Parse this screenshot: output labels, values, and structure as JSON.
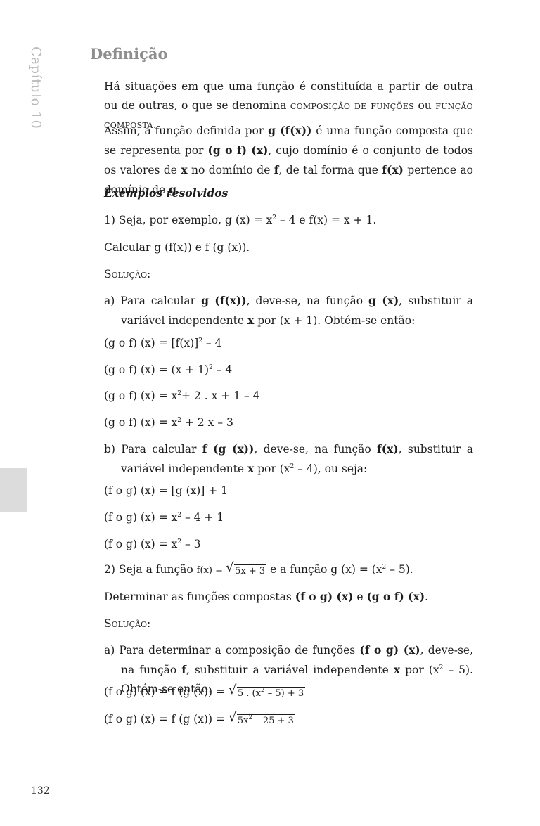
{
  "side": {
    "chapter": "Capítulo 10",
    "page_number": "132"
  },
  "heading": "Definição",
  "intro": {
    "p1_text": "Há situações em que uma função é constituída a partir de outra ou de outras, o que se denomina ",
    "p1_term1": "composição de funções",
    "p1_or": " ou ",
    "p1_term2": "função composta",
    "p1_end": ".",
    "p2_a": "Assim, a função definida por ",
    "p2_b": "g (f(x))",
    "p2_c": " é uma função composta que se representa por ",
    "p2_d": "(g o f) (x)",
    "p2_e": ", cujo domínio é o conjunto de todos os valores de ",
    "p2_f": "x",
    "p2_g": " no domínio de ",
    "p2_h": "f",
    "p2_i": ", de tal forma que ",
    "p2_j": "f(x)",
    "p2_k": " pertence ao domínio de ",
    "p2_l": "g",
    "p2_m": "."
  },
  "examples_title": "Exemplos resolvidos",
  "ex1": {
    "stmt_a": "1)  Seja, por exemplo, g (x) = x",
    "stmt_sup": "2",
    "stmt_b": " – 4 e f(x) = x + 1.",
    "task": "Calcular g (f(x)) e f (g (x)).",
    "solution_label": "Solução:",
    "a_1": "a)  Para calcular ",
    "a_2": "g (f(x))",
    "a_3": ", deve-se, na função ",
    "a_4": "g (x)",
    "a_5": ", substituir a variável independente ",
    "a_6": "x",
    "a_7": " por (x + 1). Obtém-se então:",
    "eq1_a": "(g o f) (x) = [f(x)]",
    "eq1_b": " – 4",
    "eq2_a": "(g o f) (x) = (x + 1)",
    "eq2_b": " – 4",
    "eq3_a": "(g o f) (x) = x",
    "eq3_b": "+ 2 . x + 1 – 4",
    "eq4_a": "(g o f) (x) = x",
    "eq4_b": " + 2 x – 3",
    "b_1": "b)  Para calcular ",
    "b_2": "f (g (x))",
    "b_3": ", deve-se, na função ",
    "b_4": "f(x)",
    "b_5": ", substituir a variável independente ",
    "b_6": "x",
    "b_7": " por (x",
    "b_8": " – 4), ou seja:",
    "eq5": "(f o g) (x) = [g (x)] + 1",
    "eq6_a": "(f o g) (x) = x",
    "eq6_b": " – 4 + 1",
    "eq7_a": "(f o g) (x) = x",
    "eq7_b": " – 3",
    "sq": "2"
  },
  "ex2": {
    "stmt_a": "2)  Seja a função ",
    "fx_label": "f(x) = ",
    "fx_rad": "5x + 3",
    "stmt_b": " e a função g (x) = (x",
    "stmt_c": " – 5).",
    "task_a": "Determinar as funções compostas ",
    "task_b": "(f o g) (x)",
    "task_c": " e ",
    "task_d": "(g o f) (x)",
    "task_e": ".",
    "solution_label": "Solução:",
    "a_1": "a)  Para determinar a composição de funções ",
    "a_2": "(f o g) (x)",
    "a_3": ", deve-se, na função ",
    "a_4": "f",
    "a_5": ", substituir a variável independente ",
    "a_6": "x",
    "a_7": " por (x",
    "a_8": " – 5). Obtém-se então:",
    "eq1_label": "(f o g) (x) = f (g (x)) = ",
    "eq1_rad_a": "5 . (x",
    "eq1_rad_b": " – 5) + 3",
    "eq2_label": "(f o g) (x) = f (g (x)) = ",
    "eq2_rad_a": "5x",
    "eq2_rad_b": " – 25 + 3",
    "sq": "2"
  }
}
